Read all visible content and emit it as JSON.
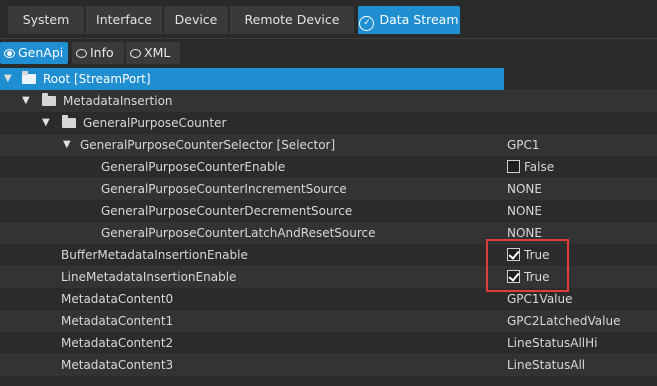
{
  "tabs": [
    {
      "label": "System",
      "active": false
    },
    {
      "label": "Interface",
      "active": false
    },
    {
      "label": "Device",
      "active": false
    },
    {
      "label": "Remote Device",
      "active": false
    },
    {
      "label": "Data Stream",
      "active": true
    }
  ],
  "subtabs": [
    {
      "label": "GenApi",
      "active": true
    },
    {
      "label": "Info",
      "active": false
    },
    {
      "label": "XML",
      "active": false
    }
  ],
  "tree": [
    {
      "name": "Root [StreamPort]",
      "value": "",
      "kind": "folder",
      "expanded": true,
      "selected": true
    },
    {
      "name": "MetadataInsertion",
      "value": "",
      "kind": "folder",
      "expanded": true
    },
    {
      "name": "GeneralPurposeCounter",
      "value": "",
      "kind": "folder",
      "expanded": true
    },
    {
      "name": "GeneralPurposeCounterSelector [Selector]",
      "value": "GPC1",
      "kind": "node",
      "expanded": true
    },
    {
      "name": "GeneralPurposeCounterEnable",
      "value": "False",
      "kind": "bool",
      "checked": false
    },
    {
      "name": "GeneralPurposeCounterIncrementSource",
      "value": "NONE",
      "kind": "enum"
    },
    {
      "name": "GeneralPurposeCounterDecrementSource",
      "value": "NONE",
      "kind": "enum"
    },
    {
      "name": "GeneralPurposeCounterLatchAndResetSource",
      "value": "NONE",
      "kind": "enum"
    },
    {
      "name": "BufferMetadataInsertionEnable",
      "value": "True",
      "kind": "bool",
      "checked": true
    },
    {
      "name": "LineMetadataInsertionEnable",
      "value": "True",
      "kind": "bool",
      "checked": true
    },
    {
      "name": "MetadataContent0",
      "value": "GPC1Value",
      "kind": "enum"
    },
    {
      "name": "MetadataContent1",
      "value": "GPC2LatchedValue",
      "kind": "enum"
    },
    {
      "name": "MetadataContent2",
      "value": "LineStatusAllHi",
      "kind": "enum"
    },
    {
      "name": "MetadataContent3",
      "value": "LineStatusAll",
      "kind": "enum"
    }
  ],
  "colors": {
    "accent": "#1f8fd1",
    "highlight": "#e03c3c",
    "background": "#2b2b2b"
  }
}
